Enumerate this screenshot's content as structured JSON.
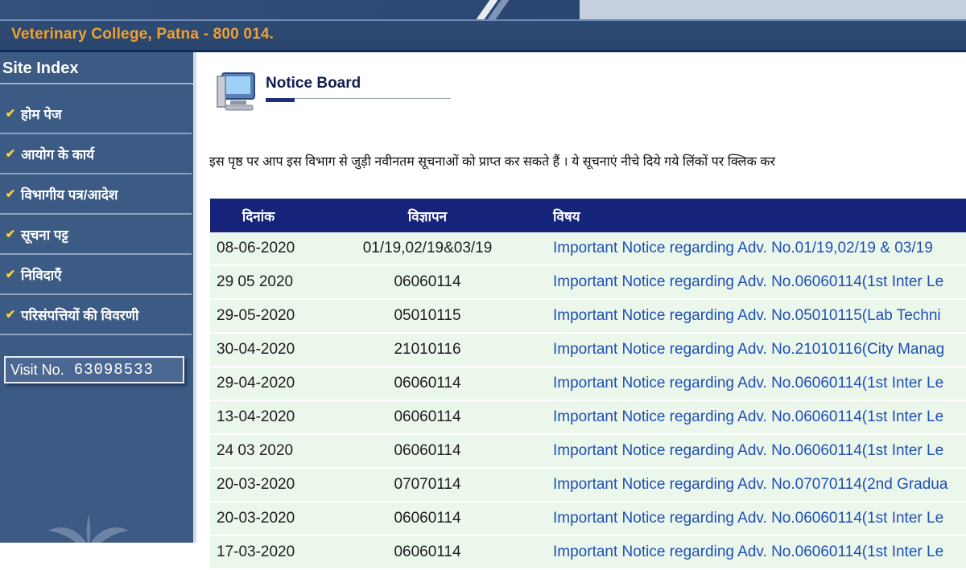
{
  "header": {
    "address": "Veterinary College, Patna - 800 014."
  },
  "sidebar": {
    "title": "Site Index",
    "items": [
      {
        "label": "होम पेज"
      },
      {
        "label": "आयोग के कार्य"
      },
      {
        "label": "विभागीय पत्र/आदेश"
      },
      {
        "label": "सूचना पट्ट"
      },
      {
        "label": "निविदाएँ"
      },
      {
        "label": "परिसंपत्तियों की विवरणी"
      }
    ],
    "visit_label": "Visit No.",
    "visit_number": "63098533"
  },
  "main": {
    "title": "Notice Board",
    "intro": "इस पृष्ठ पर आप इस विभाग से जुड़ी नवीनतम सूचनाओं को प्राप्त कर सकते हैं । ये सूचनाएं नीचे दिये गये लिंकों पर क्लिक कर",
    "table": {
      "headers": {
        "date": "दिनांक",
        "adv": "विज्ञापन",
        "subject": "विषय"
      },
      "rows": [
        {
          "date": "08-06-2020",
          "adv": "01/19,02/19&03/19",
          "subject": "Important Notice regarding Adv. No.01/19,02/19 & 03/19"
        },
        {
          "date": "29 05 2020",
          "adv": "06060114",
          "subject": "Important Notice regarding Adv. No.06060114(1st Inter Le"
        },
        {
          "date": "29-05-2020",
          "adv": "05010115",
          "subject": "Important Notice regarding Adv. No.05010115(Lab Techni"
        },
        {
          "date": "30-04-2020",
          "adv": "21010116",
          "subject": "Important Notice regarding Adv. No.21010116(City Manag"
        },
        {
          "date": "29-04-2020",
          "adv": "06060114",
          "subject": "Important Notice regarding Adv. No.06060114(1st Inter Le"
        },
        {
          "date": "13-04-2020",
          "adv": "06060114",
          "subject": "Important Notice regarding Adv. No.06060114(1st Inter Le"
        },
        {
          "date": "24 03 2020",
          "adv": "06060114",
          "subject": "Important Notice regarding Adv. No.06060114(1st Inter Le"
        },
        {
          "date": "20-03-2020",
          "adv": "07070114",
          "subject": "Important Notice regarding Adv. No.07070114(2nd Gradua"
        },
        {
          "date": "20-03-2020",
          "adv": "06060114",
          "subject": "Important Notice regarding Adv. No.06060114(1st Inter Le"
        },
        {
          "date": "17-03-2020",
          "adv": "06060114",
          "subject": "Important Notice regarding Adv. No.06060114(1st Inter Le"
        }
      ]
    }
  },
  "colors": {
    "sidebar_bg": "#3b5a84",
    "address_text": "#f0a032",
    "table_header_bg": "#16237a",
    "row_bg": "#ecf7ec",
    "link": "#1e4fb5"
  }
}
